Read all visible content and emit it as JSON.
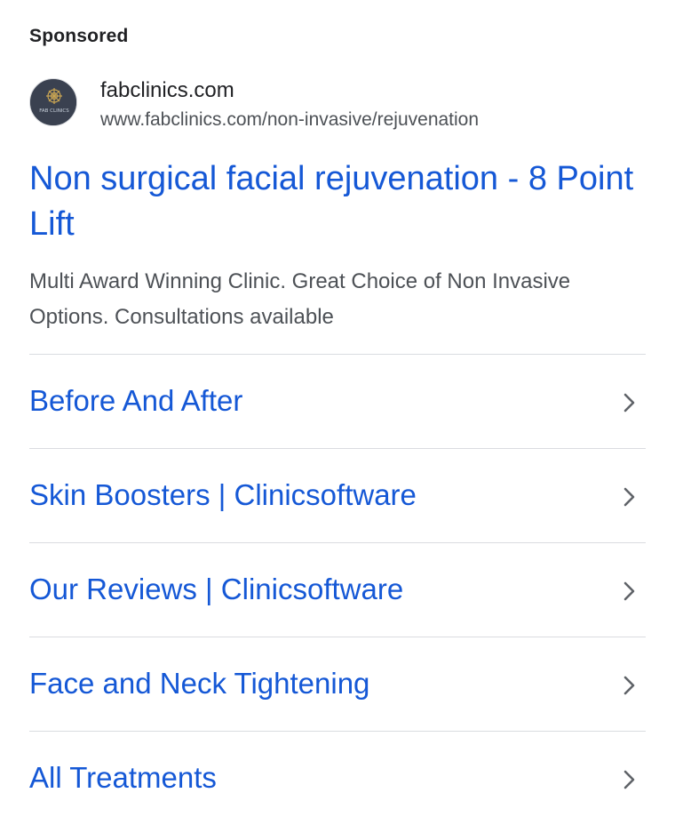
{
  "ad": {
    "sponsored_label": "Sponsored",
    "favicon_text": "FAB CLINICS",
    "site_name": "fabclinics.com",
    "display_url": "www.fabclinics.com/non-invasive/rejuvenation",
    "headline": "Non surgical facial rejuvenation - 8 Point Lift",
    "description": "Multi Award Winning Clinic. Great Choice of Non Invasive Options. Consultations available"
  },
  "sitelinks": [
    {
      "label": "Before And After",
      "icon": "chevron-right-icon"
    },
    {
      "label": "Skin Boosters | Clinicsoftware",
      "icon": "chevron-right-icon"
    },
    {
      "label": "Our Reviews | Clinicsoftware",
      "icon": "chevron-right-icon"
    },
    {
      "label": "Face and Neck Tightening",
      "icon": "chevron-right-icon"
    },
    {
      "label": "All Treatments",
      "icon": "chevron-right-icon"
    }
  ],
  "colors": {
    "link": "#1558d6",
    "text": "#202124",
    "muted": "#4d5156",
    "divider": "#dadce0",
    "favicon_bg": "#3a4150",
    "favicon_gold": "#c9a553"
  }
}
